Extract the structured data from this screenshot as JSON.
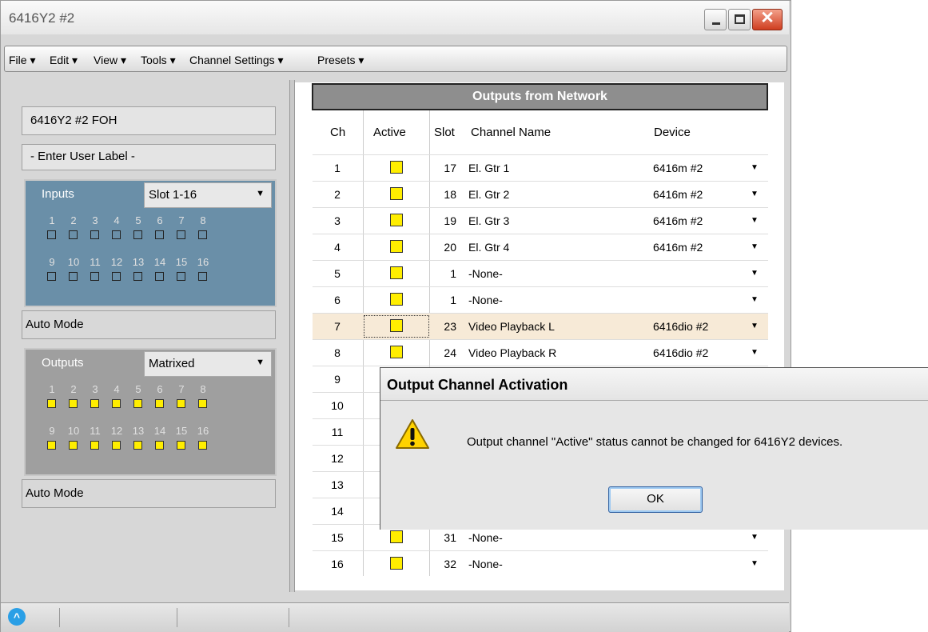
{
  "window": {
    "title": "6416Y2 #2"
  },
  "menu": [
    "File ▾",
    "Edit ▾",
    "View ▾",
    "Tools ▾",
    "Channel Settings ▾",
    "Presets ▾"
  ],
  "left": {
    "device_label": "6416Y2 #2 FOH",
    "user_label": "- Enter User Label -",
    "inputs": {
      "label": "Inputs",
      "slot": "Slot 1-16",
      "mode": "Auto Mode",
      "numbers": [
        "1",
        "2",
        "3",
        "4",
        "5",
        "6",
        "7",
        "8",
        "9",
        "10",
        "11",
        "12",
        "13",
        "14",
        "15",
        "16"
      ]
    },
    "outputs": {
      "label": "Outputs",
      "slot": "Matrixed",
      "mode": "Auto Mode",
      "numbers": [
        "1",
        "2",
        "3",
        "4",
        "5",
        "6",
        "7",
        "8",
        "9",
        "10",
        "11",
        "12",
        "13",
        "14",
        "15",
        "16"
      ]
    }
  },
  "table": {
    "title": "Outputs from Network",
    "headers": {
      "ch": "Ch",
      "active": "Active",
      "slot": "Slot",
      "name": "Channel Name",
      "device": "Device"
    },
    "rows": [
      {
        "ch": "1",
        "slot": "17",
        "name": "El. Gtr 1",
        "device": "6416m #2"
      },
      {
        "ch": "2",
        "slot": "18",
        "name": "El. Gtr 2",
        "device": "6416m #2"
      },
      {
        "ch": "3",
        "slot": "19",
        "name": "El. Gtr 3",
        "device": "6416m #2"
      },
      {
        "ch": "4",
        "slot": "20",
        "name": "El. Gtr 4",
        "device": "6416m #2"
      },
      {
        "ch": "5",
        "slot": "1",
        "name": "-None-",
        "device": ""
      },
      {
        "ch": "6",
        "slot": "1",
        "name": "-None-",
        "device": ""
      },
      {
        "ch": "7",
        "slot": "23",
        "name": "Video Playback L",
        "device": "6416dio #2"
      },
      {
        "ch": "8",
        "slot": "24",
        "name": "Video Playback R",
        "device": "6416dio #2"
      },
      {
        "ch": "9",
        "slot": "",
        "name": "",
        "device": ""
      },
      {
        "ch": "10",
        "slot": "",
        "name": "",
        "device": ""
      },
      {
        "ch": "11",
        "slot": "",
        "name": "",
        "device": ""
      },
      {
        "ch": "12",
        "slot": "",
        "name": "",
        "device": ""
      },
      {
        "ch": "13",
        "slot": "",
        "name": "",
        "device": ""
      },
      {
        "ch": "14",
        "slot": "",
        "name": "",
        "device": ""
      },
      {
        "ch": "15",
        "slot": "31",
        "name": "-None-",
        "device": ""
      },
      {
        "ch": "16",
        "slot": "32",
        "name": "-None-",
        "device": ""
      }
    ],
    "selected_ch": "7"
  },
  "dialog": {
    "title": "Output Channel Activation",
    "message": "Output channel \"Active\" status cannot be changed for 6416Y2 devices.",
    "ok": "OK"
  },
  "colors": {
    "inputs_panel": "#6a8fa8",
    "outputs_panel": "#9f9f9f",
    "active_yellow": "#ffee00",
    "selected_row": "#f7ead7"
  },
  "icons": {
    "status": "dante-logo-icon",
    "dialog": "warning-icon"
  }
}
